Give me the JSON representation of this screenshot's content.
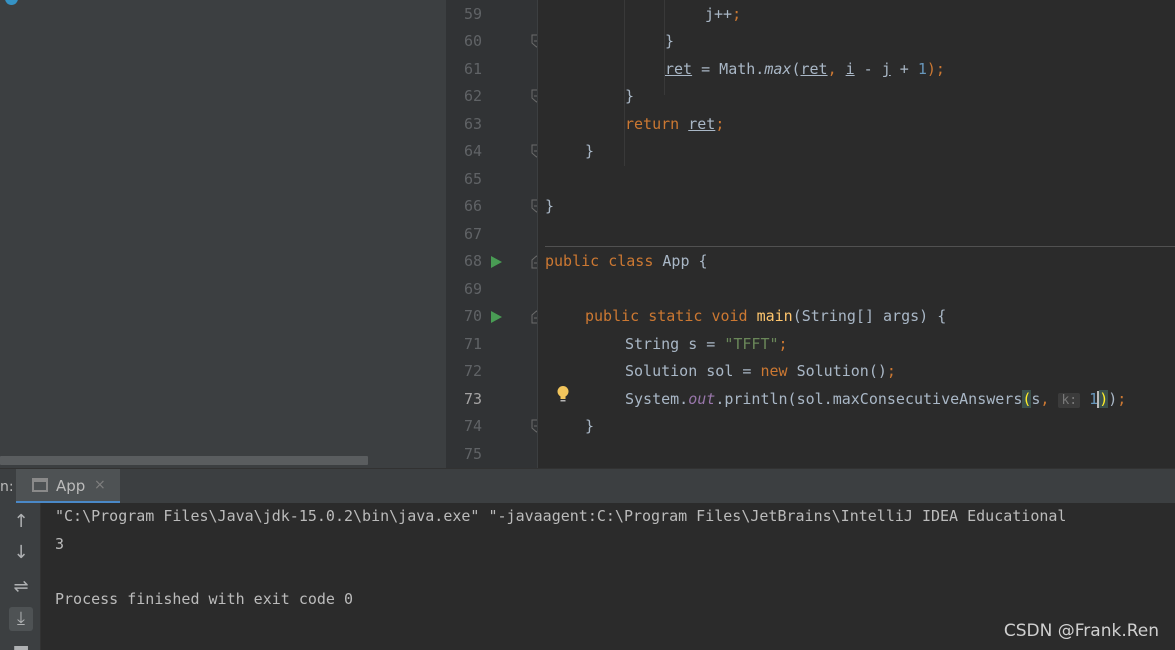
{
  "project_panel": {},
  "gutter": {
    "line_numbers": [
      "59",
      "60",
      "61",
      "62",
      "63",
      "64",
      "65",
      "66",
      "67",
      "68",
      "69",
      "70",
      "71",
      "72",
      "73",
      "74",
      "75"
    ],
    "current_line": "73"
  },
  "code": {
    "l59": {
      "a": "j++",
      "b": ";"
    },
    "l60": {
      "a": "}"
    },
    "l61": {
      "a": "ret",
      "b": " = Math.",
      "c": "max",
      "d": "(",
      "e": "ret",
      "f": ", ",
      "g": "i",
      "h": " - ",
      "i": "j",
      "j": " + ",
      "k": "1",
      "l": ");"
    },
    "l62": {
      "a": "}"
    },
    "l63": {
      "a": "return",
      "b": " ",
      "c": "ret",
      "d": ";"
    },
    "l64": {
      "a": "}"
    },
    "l66": {
      "a": "}"
    },
    "l68": {
      "a": "public",
      "b": " ",
      "c": "class",
      "d": " App {"
    },
    "l70": {
      "a": "public",
      "b": " ",
      "c": "static",
      "d": " ",
      "e": "void",
      "f": " ",
      "g": "main",
      "h": "(String[] args) {"
    },
    "l71": {
      "a": "String s = ",
      "b": "\"TFFT\"",
      "c": ";"
    },
    "l72": {
      "a": "Solution sol = ",
      "b": "new",
      "c": " Solution()",
      "d": ";"
    },
    "l73": {
      "a": "System.",
      "b": "out",
      "c": ".println(sol.maxConsecutiveAnswers",
      "d": "(",
      "e": "s",
      "f": ",",
      "g": " ",
      "h": "k:",
      "i": " ",
      "j": "1",
      "k": ")",
      "l": ")",
      "m": ";"
    },
    "l74": {
      "a": "}"
    }
  },
  "run_window": {
    "prefix": "n:",
    "tab_label": "App",
    "tab_close": "×",
    "toolbar": [
      "up-arrow",
      "down-arrow",
      "soft-wrap",
      "scroll-to-end",
      "more"
    ],
    "console_lines": [
      "\"C:\\Program Files\\Java\\jdk-15.0.2\\bin\\java.exe\" \"-javaagent:C:\\Program Files\\JetBrains\\IntelliJ IDEA Educational",
      "3",
      "",
      "Process finished with exit code 0"
    ]
  },
  "watermark": "CSDN @Frank.Ren",
  "colors": {
    "keyword": "#cc7832",
    "method": "#ffc66d",
    "string": "#6a8759",
    "number": "#6897bb",
    "static_field": "#9876aa",
    "run_icon": "#499c54",
    "background": "#2b2b2b"
  }
}
